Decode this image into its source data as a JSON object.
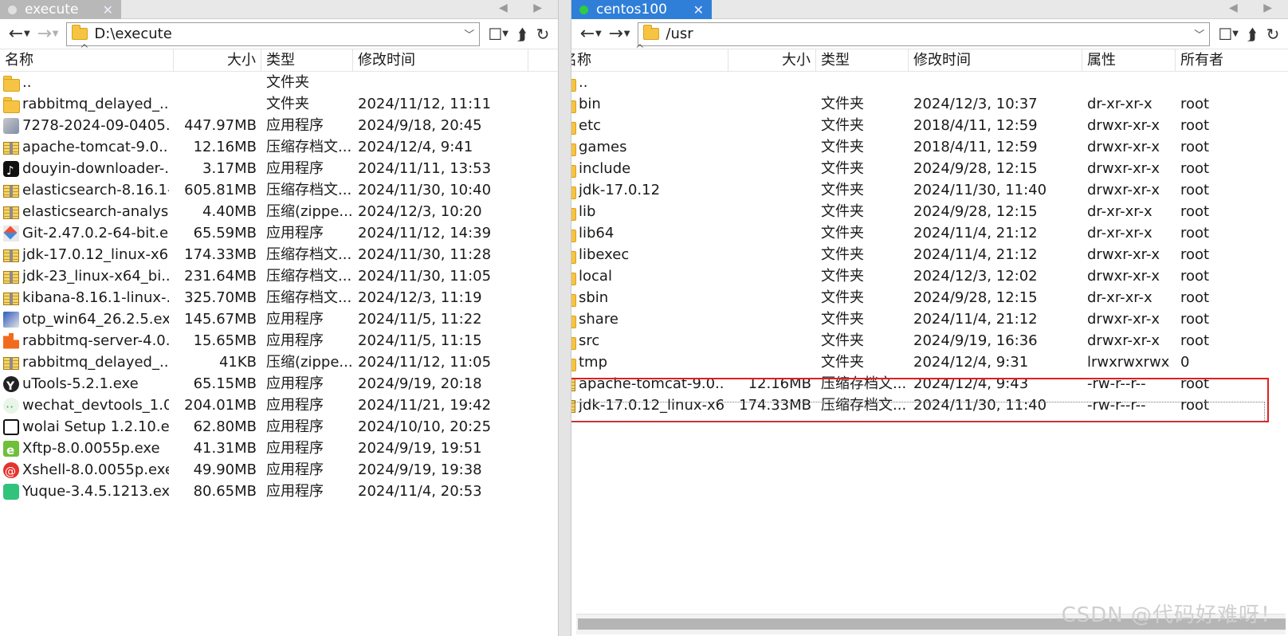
{
  "left": {
    "tab": {
      "label": "execute",
      "close": "✕",
      "dot_color": "#e0e0e0"
    },
    "path": "D:\\execute",
    "columns": {
      "name": "名称",
      "size": "大小",
      "type": "类型",
      "modified": "修改时间"
    },
    "rows": [
      {
        "icon": "folder",
        "name": "..",
        "size": "",
        "type": "文件夹",
        "modified": ""
      },
      {
        "icon": "folder",
        "name": "rabbitmq_delayed_...",
        "size": "",
        "type": "文件夹",
        "modified": "2024/11/12, 11:11"
      },
      {
        "icon": "exe1",
        "name": "7278-2024-09-0405...",
        "size": "447.97MB",
        "type": "应用程序",
        "modified": "2024/9/18, 20:45"
      },
      {
        "icon": "archive",
        "name": "apache-tomcat-9.0....",
        "size": "12.16MB",
        "type": "压缩存档文...",
        "modified": "2024/12/4, 9:41"
      },
      {
        "icon": "tiktok",
        "name": "douyin-downloader-...",
        "size": "3.17MB",
        "type": "应用程序",
        "modified": "2024/11/11, 13:53"
      },
      {
        "icon": "archive",
        "name": "elasticsearch-8.16.1-...",
        "size": "605.81MB",
        "type": "压缩存档文...",
        "modified": "2024/11/30, 10:40"
      },
      {
        "icon": "archive",
        "name": "elasticsearch-analysi...",
        "size": "4.40MB",
        "type": "压缩(zippe...",
        "modified": "2024/12/3, 10:20"
      },
      {
        "icon": "git",
        "name": "Git-2.47.0.2-64-bit.e...",
        "size": "65.59MB",
        "type": "应用程序",
        "modified": "2024/11/12, 14:39"
      },
      {
        "icon": "archive",
        "name": "jdk-17.0.12_linux-x6...",
        "size": "174.33MB",
        "type": "压缩存档文...",
        "modified": "2024/11/30, 11:28"
      },
      {
        "icon": "archive",
        "name": "jdk-23_linux-x64_bi...",
        "size": "231.64MB",
        "type": "压缩存档文...",
        "modified": "2024/11/30, 11:05"
      },
      {
        "icon": "archive",
        "name": "kibana-8.16.1-linux-...",
        "size": "325.70MB",
        "type": "压缩存档文...",
        "modified": "2024/12/3, 11:19"
      },
      {
        "icon": "otp",
        "name": "otp_win64_26.2.5.exe",
        "size": "145.67MB",
        "type": "应用程序",
        "modified": "2024/11/5, 11:22"
      },
      {
        "icon": "rabbit",
        "name": "rabbitmq-server-4.0....",
        "size": "15.65MB",
        "type": "应用程序",
        "modified": "2024/11/5, 11:15"
      },
      {
        "icon": "archive",
        "name": "rabbitmq_delayed_...",
        "size": "41KB",
        "type": "压缩(zippe...",
        "modified": "2024/11/12, 11:05"
      },
      {
        "icon": "utools",
        "name": "uTools-5.2.1.exe",
        "size": "65.15MB",
        "type": "应用程序",
        "modified": "2024/9/19, 20:18"
      },
      {
        "icon": "wechat",
        "name": "wechat_devtools_1.0...",
        "size": "204.01MB",
        "type": "应用程序",
        "modified": "2024/11/21, 19:42"
      },
      {
        "icon": "wolai",
        "name": "wolai Setup 1.2.10.exe",
        "size": "62.80MB",
        "type": "应用程序",
        "modified": "2024/10/10, 20:25"
      },
      {
        "icon": "xftp",
        "name": "Xftp-8.0.0055p.exe",
        "size": "41.31MB",
        "type": "应用程序",
        "modified": "2024/9/19, 19:51"
      },
      {
        "icon": "xshell",
        "name": "Xshell-8.0.0055p.exe",
        "size": "49.90MB",
        "type": "应用程序",
        "modified": "2024/9/19, 19:38"
      },
      {
        "icon": "yuque",
        "name": "Yuque-3.4.5.1213.exe",
        "size": "80.65MB",
        "type": "应用程序",
        "modified": "2024/11/4, 20:53"
      }
    ]
  },
  "right": {
    "tab": {
      "label": "centos100",
      "close": "✕",
      "dot_color": "#2ecc40"
    },
    "path": "/usr",
    "columns": {
      "name": "名称",
      "size": "大小",
      "type": "类型",
      "modified": "修改时间",
      "attr": "属性",
      "owner": "所有者"
    },
    "rows": [
      {
        "icon": "folder",
        "name": "..",
        "size": "",
        "type": "",
        "modified": "",
        "attr": "",
        "owner": ""
      },
      {
        "icon": "folder",
        "name": "bin",
        "size": "",
        "type": "文件夹",
        "modified": "2024/12/3, 10:37",
        "attr": "dr-xr-xr-x",
        "owner": "root"
      },
      {
        "icon": "folder",
        "name": "etc",
        "size": "",
        "type": "文件夹",
        "modified": "2018/4/11, 12:59",
        "attr": "drwxr-xr-x",
        "owner": "root"
      },
      {
        "icon": "folder",
        "name": "games",
        "size": "",
        "type": "文件夹",
        "modified": "2018/4/11, 12:59",
        "attr": "drwxr-xr-x",
        "owner": "root"
      },
      {
        "icon": "folder",
        "name": "include",
        "size": "",
        "type": "文件夹",
        "modified": "2024/9/28, 12:15",
        "attr": "drwxr-xr-x",
        "owner": "root"
      },
      {
        "icon": "folder",
        "name": "jdk-17.0.12",
        "size": "",
        "type": "文件夹",
        "modified": "2024/11/30, 11:40",
        "attr": "drwxr-xr-x",
        "owner": "root"
      },
      {
        "icon": "folder",
        "name": "lib",
        "size": "",
        "type": "文件夹",
        "modified": "2024/9/28, 12:15",
        "attr": "dr-xr-xr-x",
        "owner": "root"
      },
      {
        "icon": "folder",
        "name": "lib64",
        "size": "",
        "type": "文件夹",
        "modified": "2024/11/4, 21:12",
        "attr": "dr-xr-xr-x",
        "owner": "root"
      },
      {
        "icon": "folder",
        "name": "libexec",
        "size": "",
        "type": "文件夹",
        "modified": "2024/11/4, 21:12",
        "attr": "drwxr-xr-x",
        "owner": "root"
      },
      {
        "icon": "folder",
        "name": "local",
        "size": "",
        "type": "文件夹",
        "modified": "2024/12/3, 12:02",
        "attr": "drwxr-xr-x",
        "owner": "root"
      },
      {
        "icon": "folder",
        "name": "sbin",
        "size": "",
        "type": "文件夹",
        "modified": "2024/9/28, 12:15",
        "attr": "dr-xr-xr-x",
        "owner": "root"
      },
      {
        "icon": "folder",
        "name": "share",
        "size": "",
        "type": "文件夹",
        "modified": "2024/11/4, 21:12",
        "attr": "drwxr-xr-x",
        "owner": "root"
      },
      {
        "icon": "folder",
        "name": "src",
        "size": "",
        "type": "文件夹",
        "modified": "2024/9/19, 16:36",
        "attr": "drwxr-xr-x",
        "owner": "root"
      },
      {
        "icon": "link",
        "name": "tmp",
        "size": "",
        "type": "文件夹",
        "modified": "2024/12/4, 9:31",
        "attr": "lrwxrwxrwx",
        "owner": "0"
      },
      {
        "icon": "archive",
        "name": "apache-tomcat-9.0....",
        "size": "12.16MB",
        "type": "压缩存档文...",
        "modified": "2024/12/4, 9:43",
        "attr": "-rw-r--r--",
        "owner": "root"
      },
      {
        "icon": "archive",
        "name": "jdk-17.0.12_linux-x6...",
        "size": "174.33MB",
        "type": "压缩存档文...",
        "modified": "2024/11/30, 11:40",
        "attr": "-rw-r--r--",
        "owner": "root"
      }
    ]
  },
  "watermark": "CSDN @代码好难呀！",
  "highlight_color": "#e02020"
}
